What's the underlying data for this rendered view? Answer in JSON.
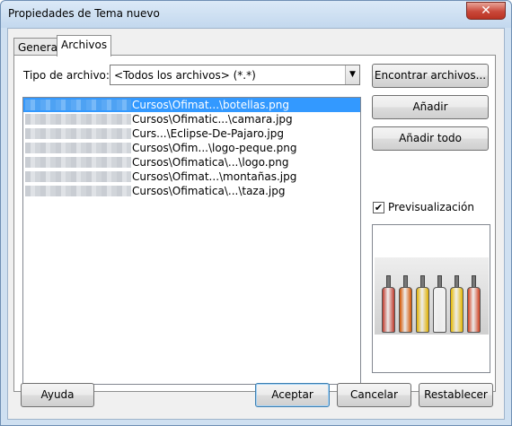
{
  "window": {
    "title": "Propiedades de Tema nuevo",
    "close_glyph": "✕"
  },
  "tabs": [
    {
      "label": "General",
      "active": false
    },
    {
      "label": "Archivos",
      "active": true
    }
  ],
  "filetype": {
    "label": "Tipo de archivo:",
    "selected": "<Todos los archivos> (*.*)",
    "arrow_glyph": "▼"
  },
  "files": [
    {
      "text": "Cursos\\Ofimat...\\botellas.png",
      "selected": true
    },
    {
      "text": "Cursos\\Ofimatic...\\camara.jpg",
      "selected": false
    },
    {
      "text": "Curs...\\Eclipse-De-Pajaro.jpg",
      "selected": false
    },
    {
      "text": "Cursos\\Ofim...\\logo-peque.png",
      "selected": false
    },
    {
      "text": "Cursos\\Ofimatica\\...\\logo.png",
      "selected": false
    },
    {
      "text": "Cursos\\Ofimat...\\montañas.jpg",
      "selected": false
    },
    {
      "text": "Cursos\\Ofimatica\\...\\taza.jpg",
      "selected": false
    }
  ],
  "side_buttons": {
    "find": "Encontrar archivos...",
    "add": "Añadir",
    "add_all": "Añadir todo"
  },
  "preview": {
    "label": "Previsualización",
    "checked": true,
    "check_glyph": "✔"
  },
  "footer": {
    "help": "Ayuda",
    "accept": "Aceptar",
    "cancel": "Cancelar",
    "reset": "Restablecer"
  },
  "colors": {
    "selection": "#3399ff",
    "window_frame": "#cfe0f1",
    "close_button": "#c9483a"
  },
  "bottle_colors": [
    "#c0392b",
    "#d35400",
    "#e0b000",
    "#f2f2f2",
    "#e6b800",
    "#d04020"
  ]
}
